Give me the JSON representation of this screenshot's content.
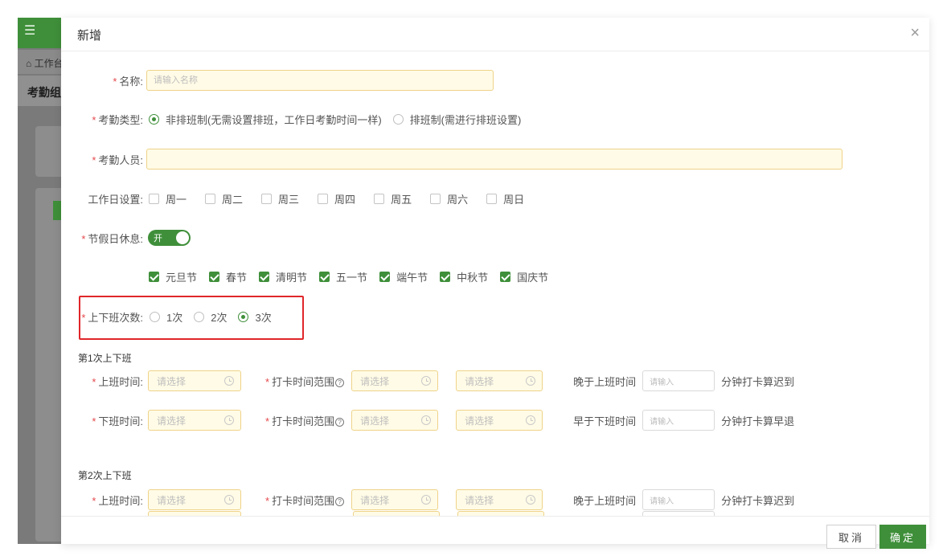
{
  "background": {
    "menu_icon": "menu-icon",
    "breadcrumb": "⌂ 工作台",
    "page_title": "考勤组管理"
  },
  "modal": {
    "title": "新增",
    "close": "×"
  },
  "form": {
    "name": {
      "label": "名称:",
      "placeholder": "请输入名称"
    },
    "type": {
      "label": "考勤类型:",
      "options": [
        "非排班制(无需设置排班，工作日考勤时间一样)",
        "排班制(需进行排班设置)"
      ],
      "selected": 0
    },
    "members": {
      "label": "考勤人员:",
      "placeholder": ""
    },
    "workdays": {
      "label": "工作日设置:",
      "days": [
        "周一",
        "周二",
        "周三",
        "周四",
        "周五",
        "周六",
        "周日"
      ]
    },
    "holiday_rest": {
      "label": "节假日休息:",
      "switch_text": "开",
      "on": true
    },
    "holidays": [
      "元旦节",
      "春节",
      "清明节",
      "五一节",
      "端午节",
      "中秋节",
      "国庆节"
    ],
    "times": {
      "label": "上下班次数:",
      "options": [
        "1次",
        "2次",
        "3次"
      ],
      "selected": 2
    },
    "shift_labels": {
      "on_time": "上班时间:",
      "off_time": "下班时间:",
      "range": "打卡时间范围",
      "select": "请选择",
      "input": "请输入",
      "late_prefix": "晚于上班时间",
      "late_suffix": "分钟打卡算迟到",
      "early_prefix": "早于下班时间",
      "early_suffix": "分钟打卡算早退"
    },
    "shifts": [
      {
        "title": "第1次上下班"
      },
      {
        "title": "第2次上下班"
      }
    ]
  },
  "footer": {
    "cancel": "取消",
    "ok": "确定"
  },
  "colors": {
    "primary": "#3f8f3a",
    "required": "#e5484d",
    "highlight": "#e0262a"
  }
}
